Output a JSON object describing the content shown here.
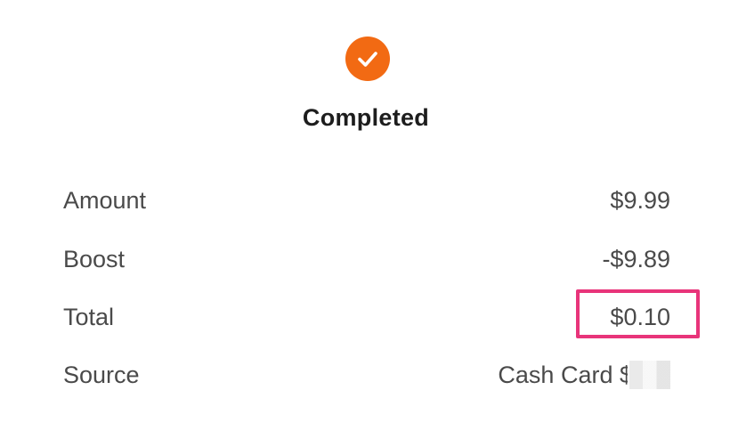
{
  "status": {
    "icon": "check-circle-icon",
    "icon_color": "#f26a13",
    "title": "Completed"
  },
  "details": [
    {
      "label": "Amount",
      "value": "$9.99"
    },
    {
      "label": "Boost",
      "value": "-$9.89"
    },
    {
      "label": "Total",
      "value": "$0.10",
      "highlighted": true
    },
    {
      "label": "Source",
      "value": "Cash Card",
      "redacted_suffix": true
    }
  ],
  "highlight_color": "#e8347a",
  "source_partial": "$"
}
